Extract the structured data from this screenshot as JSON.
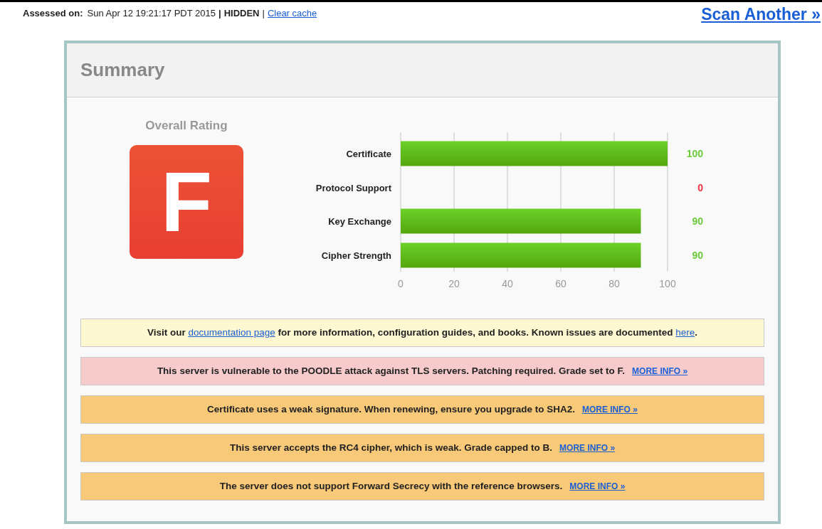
{
  "header": {
    "assessed_label": "Assessed on:",
    "assessed_value": "Sun Apr 12 19:21:17 PDT 2015",
    "separator_1": "|",
    "visibility": "HIDDEN",
    "separator_2": "|",
    "clear_cache": "Clear cache",
    "scan_another": "Scan Another »"
  },
  "summary": {
    "title": "Summary",
    "overall_rating_label": "Overall Rating",
    "grade": "F",
    "chart_data": {
      "type": "bar",
      "orientation": "horizontal",
      "categories": [
        "Certificate",
        "Protocol Support",
        "Key Exchange",
        "Cipher Strength"
      ],
      "values": [
        100,
        0,
        90,
        90
      ],
      "xlim": [
        0,
        100
      ],
      "xticks": [
        0,
        20,
        40,
        60,
        80,
        100
      ],
      "data_labels": true,
      "grid": true
    },
    "messages": [
      {
        "kind": "info",
        "parts": [
          {
            "kind": "text",
            "text": "Visit our "
          },
          {
            "kind": "link",
            "text": "documentation page"
          },
          {
            "kind": "text",
            "text": " for more information, configuration guides, and books. Known issues are documented "
          },
          {
            "kind": "link",
            "text": "here"
          },
          {
            "kind": "text",
            "text": "."
          }
        ]
      },
      {
        "kind": "error",
        "parts": [
          {
            "kind": "text",
            "text": "This server is vulnerable to the POODLE attack against TLS servers. Patching required. Grade set to F."
          },
          {
            "kind": "more",
            "text": "MORE INFO »"
          }
        ]
      },
      {
        "kind": "warning",
        "parts": [
          {
            "kind": "text",
            "text": "Certificate uses a weak signature. When renewing, ensure you upgrade to SHA2."
          },
          {
            "kind": "more",
            "text": "MORE INFO »"
          }
        ]
      },
      {
        "kind": "warning",
        "parts": [
          {
            "kind": "text",
            "text": "This server accepts the RC4 cipher, which is weak. Grade capped to B."
          },
          {
            "kind": "more",
            "text": "MORE INFO »"
          }
        ]
      },
      {
        "kind": "warning",
        "parts": [
          {
            "kind": "text",
            "text": "The server does not support Forward Secrecy with the reference browsers."
          },
          {
            "kind": "more",
            "text": "MORE INFO »"
          }
        ]
      }
    ]
  }
}
